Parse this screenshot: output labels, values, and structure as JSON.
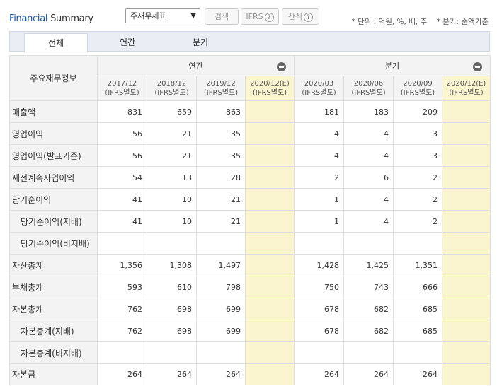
{
  "header": {
    "title_part1": "Financial",
    "title_part2": " Summary",
    "select_value": "주재무제표",
    "btn_search": "검색",
    "btn_ifrs": "IFRS",
    "btn_formula": "산식",
    "unit_note": "* 단위 : 억원, %, 배, 주",
    "quarter_note": "* 분기: 순액기준"
  },
  "tabs": [
    "전체",
    "연간",
    "분기"
  ],
  "table": {
    "corner": "주요재무정보",
    "annual_label": "연간",
    "quarter_label": "분기",
    "columns": [
      {
        "period": "2017/12",
        "basis": "(IFRS별도)"
      },
      {
        "period": "2018/12",
        "basis": "(IFRS별도)"
      },
      {
        "period": "2019/12",
        "basis": "(IFRS별도)"
      },
      {
        "period": "2020/12(E)",
        "basis": "(IFRS별도)"
      },
      {
        "period": "2020/03",
        "basis": "(IFRS별도)"
      },
      {
        "period": "2020/06",
        "basis": "(IFRS별도)"
      },
      {
        "period": "2020/09",
        "basis": "(IFRS별도)"
      },
      {
        "period": "2020/12(E)",
        "basis": "(IFRS별도)"
      }
    ],
    "rows": [
      {
        "label": "매출액",
        "values": [
          "831",
          "659",
          "863",
          "",
          "181",
          "183",
          "209",
          ""
        ]
      },
      {
        "label": "영업이익",
        "values": [
          "56",
          "21",
          "35",
          "",
          "4",
          "4",
          "3",
          ""
        ]
      },
      {
        "label": "영업이익(발표기준)",
        "values": [
          "56",
          "21",
          "35",
          "",
          "4",
          "4",
          "3",
          ""
        ]
      },
      {
        "label": "세전계속사업이익",
        "values": [
          "54",
          "13",
          "28",
          "",
          "2",
          "6",
          "2",
          ""
        ]
      },
      {
        "label": "당기순이익",
        "values": [
          "41",
          "10",
          "21",
          "",
          "1",
          "4",
          "2",
          ""
        ]
      },
      {
        "label": "당기순이익(지배)",
        "values": [
          "41",
          "10",
          "21",
          "",
          "1",
          "4",
          "2",
          ""
        ]
      },
      {
        "label": "당기순이익(비지배)",
        "values": [
          "",
          "",
          "",
          "",
          "",
          "",
          "",
          ""
        ]
      },
      {
        "label": "자산총계",
        "values": [
          "1,356",
          "1,308",
          "1,497",
          "",
          "1,428",
          "1,425",
          "1,351",
          ""
        ]
      },
      {
        "label": "부채총계",
        "values": [
          "593",
          "610",
          "798",
          "",
          "750",
          "743",
          "666",
          ""
        ]
      },
      {
        "label": "자본총계",
        "values": [
          "762",
          "698",
          "699",
          "",
          "678",
          "682",
          "685",
          ""
        ]
      },
      {
        "label": "자본총계(지배)",
        "values": [
          "762",
          "698",
          "699",
          "",
          "678",
          "682",
          "685",
          ""
        ]
      },
      {
        "label": "자본총계(비지배)",
        "values": [
          "",
          "",
          "",
          "",
          "",
          "",
          "",
          ""
        ]
      },
      {
        "label": "자본금",
        "values": [
          "264",
          "264",
          "264",
          "",
          "264",
          "264",
          "264",
          ""
        ]
      }
    ]
  }
}
